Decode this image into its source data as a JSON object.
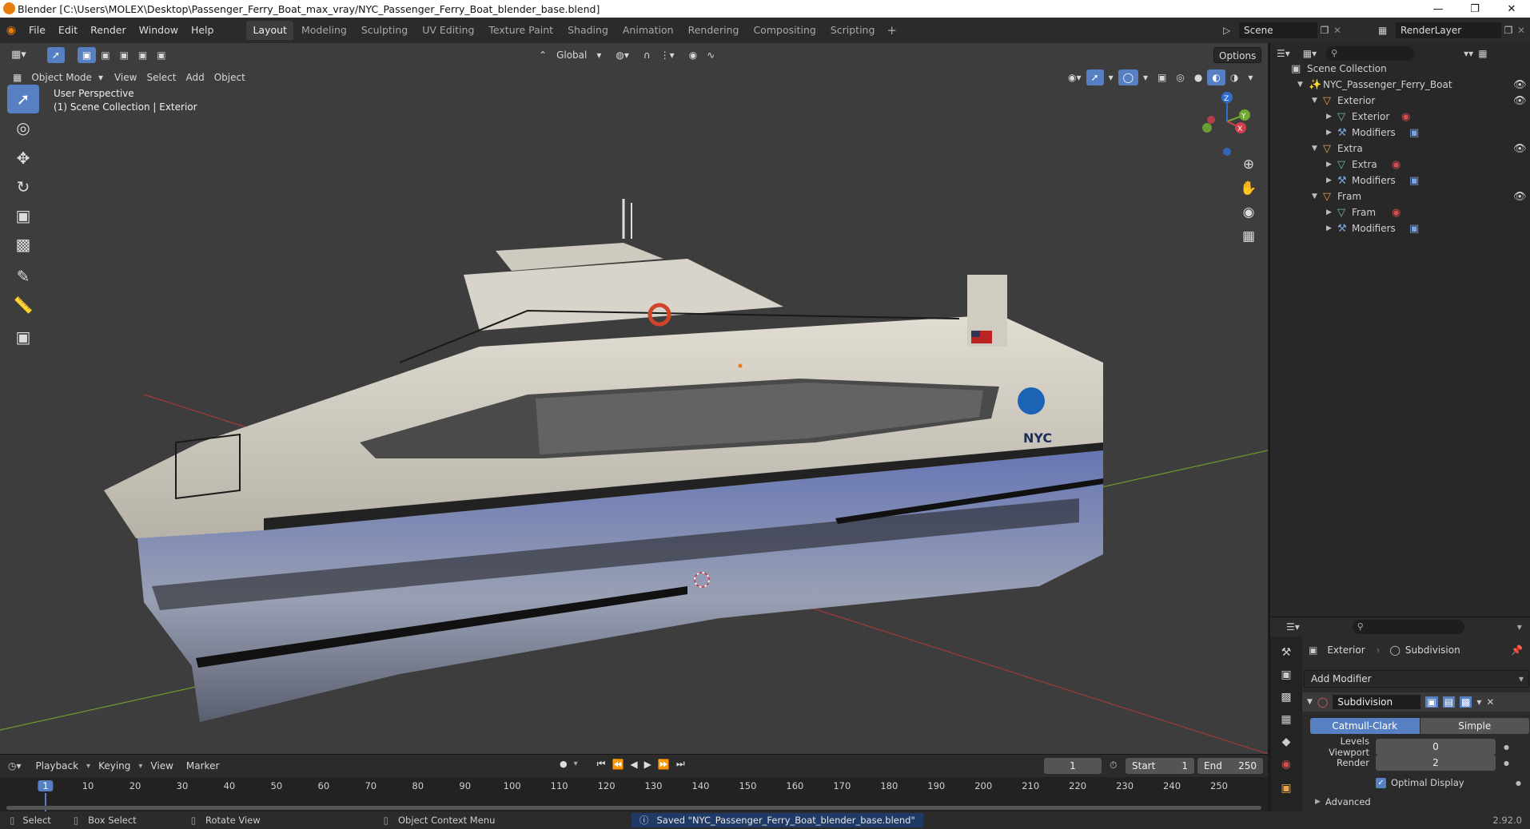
{
  "window": {
    "title": "Blender [C:\\Users\\MOLEX\\Desktop\\Passenger_Ferry_Boat_max_vray/NYC_Passenger_Ferry_Boat_blender_base.blend]"
  },
  "menus": [
    "File",
    "Edit",
    "Render",
    "Window",
    "Help"
  ],
  "workspaces": [
    "Layout",
    "Modeling",
    "Sculpting",
    "UV Editing",
    "Texture Paint",
    "Shading",
    "Animation",
    "Rendering",
    "Compositing",
    "Scripting"
  ],
  "scene": {
    "name": "Scene",
    "render_layer": "RenderLayer"
  },
  "viewport": {
    "orientation": "Global",
    "options_label": "Options",
    "mode": "Object Mode",
    "menus": [
      "View",
      "Select",
      "Add",
      "Object"
    ],
    "overlay_title": "User Perspective",
    "overlay_subtitle": "(1) Scene Collection | Exterior",
    "gizmo_axes": [
      "Z",
      "Y",
      "X"
    ]
  },
  "boat": {
    "hull_text": "NYC"
  },
  "outliner": {
    "root": "Scene Collection",
    "items": [
      {
        "label": "NYC_Passenger_Ferry_Boat"
      },
      {
        "label": "Exterior"
      },
      {
        "label": "Exterior"
      },
      {
        "label": "Modifiers"
      },
      {
        "label": "Extra"
      },
      {
        "label": "Extra"
      },
      {
        "label": "Modifiers"
      },
      {
        "label": "Fram"
      },
      {
        "label": "Fram"
      },
      {
        "label": "Modifiers"
      }
    ]
  },
  "properties": {
    "object": "Exterior",
    "modifier_name": "Subdivision",
    "add_modifier": "Add Modifier",
    "mod_instance": "Subdivision",
    "type_tabs": [
      "Catmull-Clark",
      "Simple"
    ],
    "levels_viewport_label": "Levels Viewport",
    "levels_viewport_value": "0",
    "render_label": "Render",
    "render_value": "2",
    "optimal_display": "Optimal Display",
    "advanced": "Advanced"
  },
  "timeline": {
    "menus": [
      "Playback",
      "Keying",
      "View",
      "Marker"
    ],
    "current_frame": "1",
    "start_label": "Start",
    "start_value": "1",
    "end_label": "End",
    "end_value": "250",
    "ticks": [
      "1",
      "10",
      "20",
      "30",
      "40",
      "50",
      "60",
      "70",
      "80",
      "90",
      "100",
      "110",
      "120",
      "130",
      "140",
      "150",
      "160",
      "170",
      "180",
      "190",
      "200",
      "210",
      "220",
      "230",
      "240",
      "250"
    ]
  },
  "status": {
    "select": "Select",
    "box_select": "Box Select",
    "rotate_view": "Rotate View",
    "context_menu": "Object Context Menu",
    "message": "Saved \"NYC_Passenger_Ferry_Boat_blender_base.blend\"",
    "version": "2.92.0"
  },
  "colors": {
    "accent": "#5680c2",
    "orange": "#e87d0d",
    "hull_blue": "#5b6ea8"
  }
}
